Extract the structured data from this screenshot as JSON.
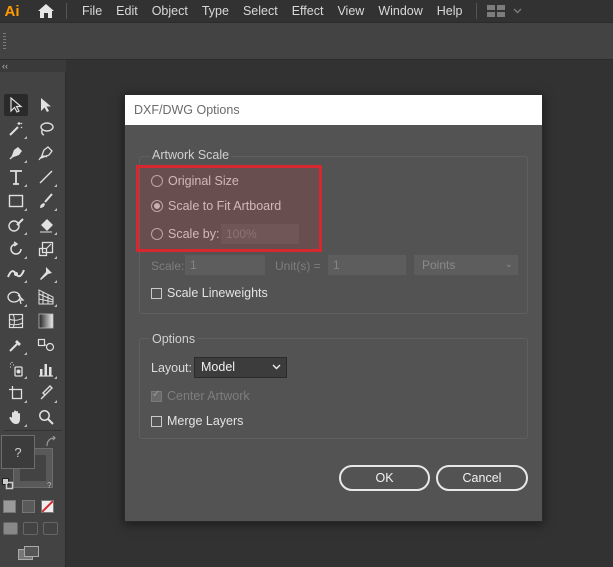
{
  "app": {
    "logo": "Ai"
  },
  "menu": {
    "items": [
      "File",
      "Edit",
      "Object",
      "Type",
      "Select",
      "Effect",
      "View",
      "Window",
      "Help"
    ]
  },
  "dialog": {
    "title": "DXF/DWG Options",
    "artwork_scale": {
      "label": "Artwork Scale",
      "original_size": "Original Size",
      "scale_to_fit": "Scale to Fit Artboard",
      "scale_by": "Scale by:",
      "scale_by_value": "100%",
      "selected": "scale_to_fit",
      "scale_label": "Scale:",
      "scale_value": "1",
      "units_label": "Unit(s) =",
      "units_value": "1",
      "units_type": "Points",
      "scale_lineweights": "Scale Lineweights",
      "scale_lineweights_checked": false
    },
    "options": {
      "label": "Options",
      "layout_label": "Layout:",
      "layout_value": "Model",
      "center_artwork": "Center Artwork",
      "center_artwork_checked": true,
      "center_artwork_disabled": true,
      "merge_layers": "Merge Layers",
      "merge_layers_checked": false
    },
    "buttons": {
      "ok": "OK",
      "cancel": "Cancel"
    }
  },
  "toolbar": {
    "fill_stroke_placeholder": "?",
    "stroke_placeholder": "?"
  },
  "colors": {
    "app_accent": "#ff9a00",
    "highlight": "#d7282f",
    "dialog_bg": "#535353",
    "canvas_bg": "#323232"
  }
}
